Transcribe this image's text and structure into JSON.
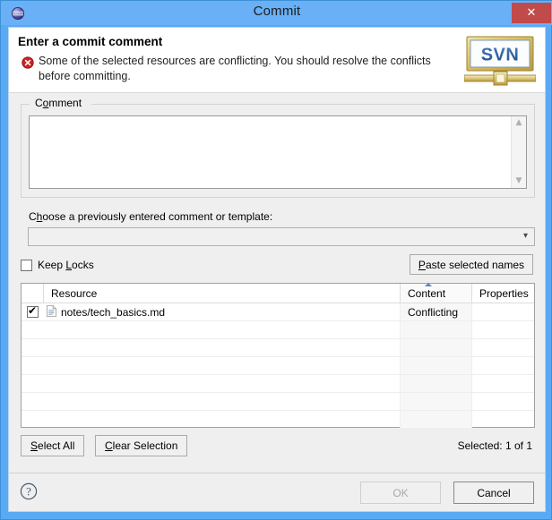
{
  "window": {
    "title": "Commit",
    "icon": "repository-globe-icon",
    "close_label": "✕"
  },
  "header": {
    "title": "Enter a commit comment",
    "message": "Some of the selected resources are conflicting. You should resolve the conflicts before committing.",
    "status_icon": "error-circle-icon",
    "logo_text": "SVN"
  },
  "comment": {
    "group_label_pre": "C",
    "group_label_mn": "o",
    "group_label_post": "mment",
    "value": "",
    "placeholder": "",
    "scroll_up": "▲",
    "scroll_down": "▼"
  },
  "template_combo": {
    "label_pre": "C",
    "label_mn": "h",
    "label_post": "oose a previously entered comment or template:",
    "selected": "",
    "arrow": "▾"
  },
  "keep_locks": {
    "label_pre": "Keep ",
    "label_mn": "L",
    "label_post": "ocks",
    "checked": false
  },
  "paste_button": {
    "label_mn": "P",
    "label_post": "aste selected names"
  },
  "table": {
    "columns": [
      "",
      "Resource",
      "Content",
      "Properties"
    ],
    "sort_column": "Content",
    "sort_direction": "asc",
    "rows": [
      {
        "checked": true,
        "icon": "file-document-icon",
        "resource": "notes/tech_basics.md",
        "content": "Conflicting",
        "properties": ""
      }
    ],
    "empty_row_count": 6
  },
  "table_actions": {
    "select_all_mn": "S",
    "select_all_post": "elect All",
    "clear_selection_mn": "C",
    "clear_selection_post": "lear Selection",
    "selected_status": "Selected: 1 of 1"
  },
  "footer": {
    "help_icon": "help-question-icon",
    "ok_label": "OK",
    "cancel_label": "Cancel",
    "ok_enabled": false
  },
  "colors": {
    "titlebar": "#69b0f7",
    "close_button": "#c14a4a",
    "error_red": "#cc2222",
    "panel": "#efefef",
    "svn_blue": "#2a5f9e"
  }
}
